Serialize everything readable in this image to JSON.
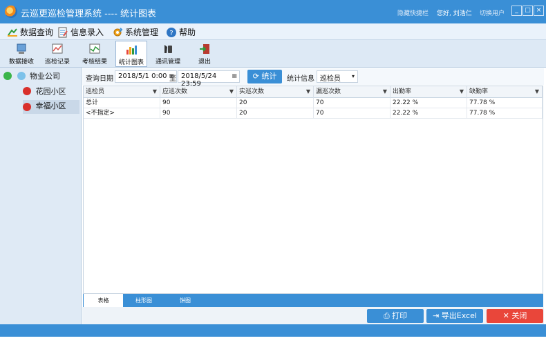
{
  "window": {
    "title": "云巡更巡检管理系统 ---- 统计图表",
    "hide_shortcuts": "隐藏快捷栏",
    "greeting": "您好, 刘浩仁",
    "switch_user": "切换用户",
    "min": "_",
    "max": "□",
    "close": "×"
  },
  "menu": [
    {
      "label": "数据查询",
      "icon": "data-query-icon"
    },
    {
      "label": "信息录入",
      "icon": "info-entry-icon"
    },
    {
      "label": "系统管理",
      "icon": "system-settings-icon"
    },
    {
      "label": "帮助",
      "icon": "help-icon"
    }
  ],
  "toolbar": [
    {
      "label": "数据接收",
      "icon": "data-receive-icon"
    },
    {
      "label": "巡检记录",
      "icon": "inspection-record-icon"
    },
    {
      "label": "考核结果",
      "icon": "assessment-result-icon"
    },
    {
      "label": "统计图表",
      "icon": "statistics-chart-icon",
      "active": true
    },
    {
      "label": "通讯管理",
      "icon": "communication-icon"
    },
    {
      "label": "退出",
      "icon": "exit-icon"
    }
  ],
  "tree": {
    "root": "物业公司",
    "children": [
      "花园小区",
      "幸福小区"
    ]
  },
  "filter": {
    "date_label": "查询日期",
    "start": "2018/5/1 0:00",
    "to": "至",
    "end": "2018/5/24 23:59",
    "stat_button": "统计",
    "info_label": "统计信息",
    "info_value": "巡检员"
  },
  "grid": {
    "columns": [
      "巡检员",
      "应巡次数",
      "实巡次数",
      "漏巡次数",
      "出勤率",
      "缺勤率"
    ],
    "rows": [
      [
        "总计",
        "90",
        "20",
        "70",
        "22.22 %",
        "77.78 %"
      ],
      [
        "<不指定>",
        "90",
        "20",
        "70",
        "22.22 %",
        "77.78 %"
      ]
    ]
  },
  "tabs": [
    "表格",
    "柱形图",
    "饼图"
  ],
  "footer": {
    "print": "打印",
    "export": "导出Excel",
    "close": "关闭"
  },
  "colors": {
    "accent": "#3a8fd6",
    "danger": "#e9463a"
  }
}
